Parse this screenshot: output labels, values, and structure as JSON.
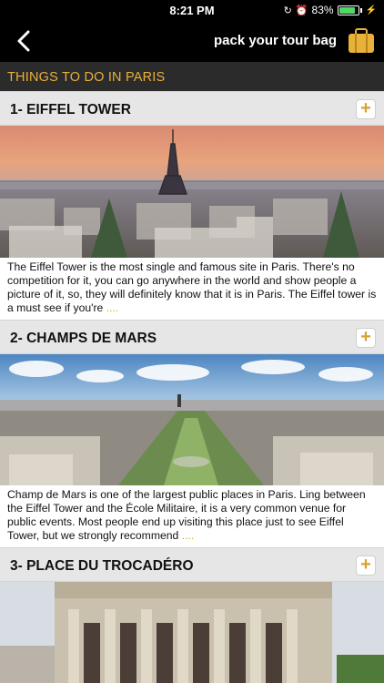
{
  "status": {
    "time": "8:21 PM",
    "battery": "83%",
    "battery_level": 0.83
  },
  "nav": {
    "title": "pack your tour bag"
  },
  "section": {
    "title": "THINGS TO DO IN PARIS"
  },
  "items": [
    {
      "title": "1- EIFFEL TOWER",
      "plus": "+",
      "description": "The Eiffel Tower is the most single and famous site in Paris. There's no competition for it, you can go anywhere in the world and show people a picture of it, so, they will definitely know that it is in Paris. The Eiffel tower is a must see if you're ",
      "more": "...."
    },
    {
      "title": "2- CHAMPS DE MARS",
      "plus": "+",
      "description": "Champ de Mars is one of the largest public places in Paris. Ling between the Eiffel Tower and the École Militaire, it is a very common venue for public events. Most people end up visiting this place just to see Eiffel Tower, but we strongly recommend ",
      "more": "...."
    },
    {
      "title": "3- PLACE DU TROCADÉRO",
      "plus": "+"
    }
  ]
}
